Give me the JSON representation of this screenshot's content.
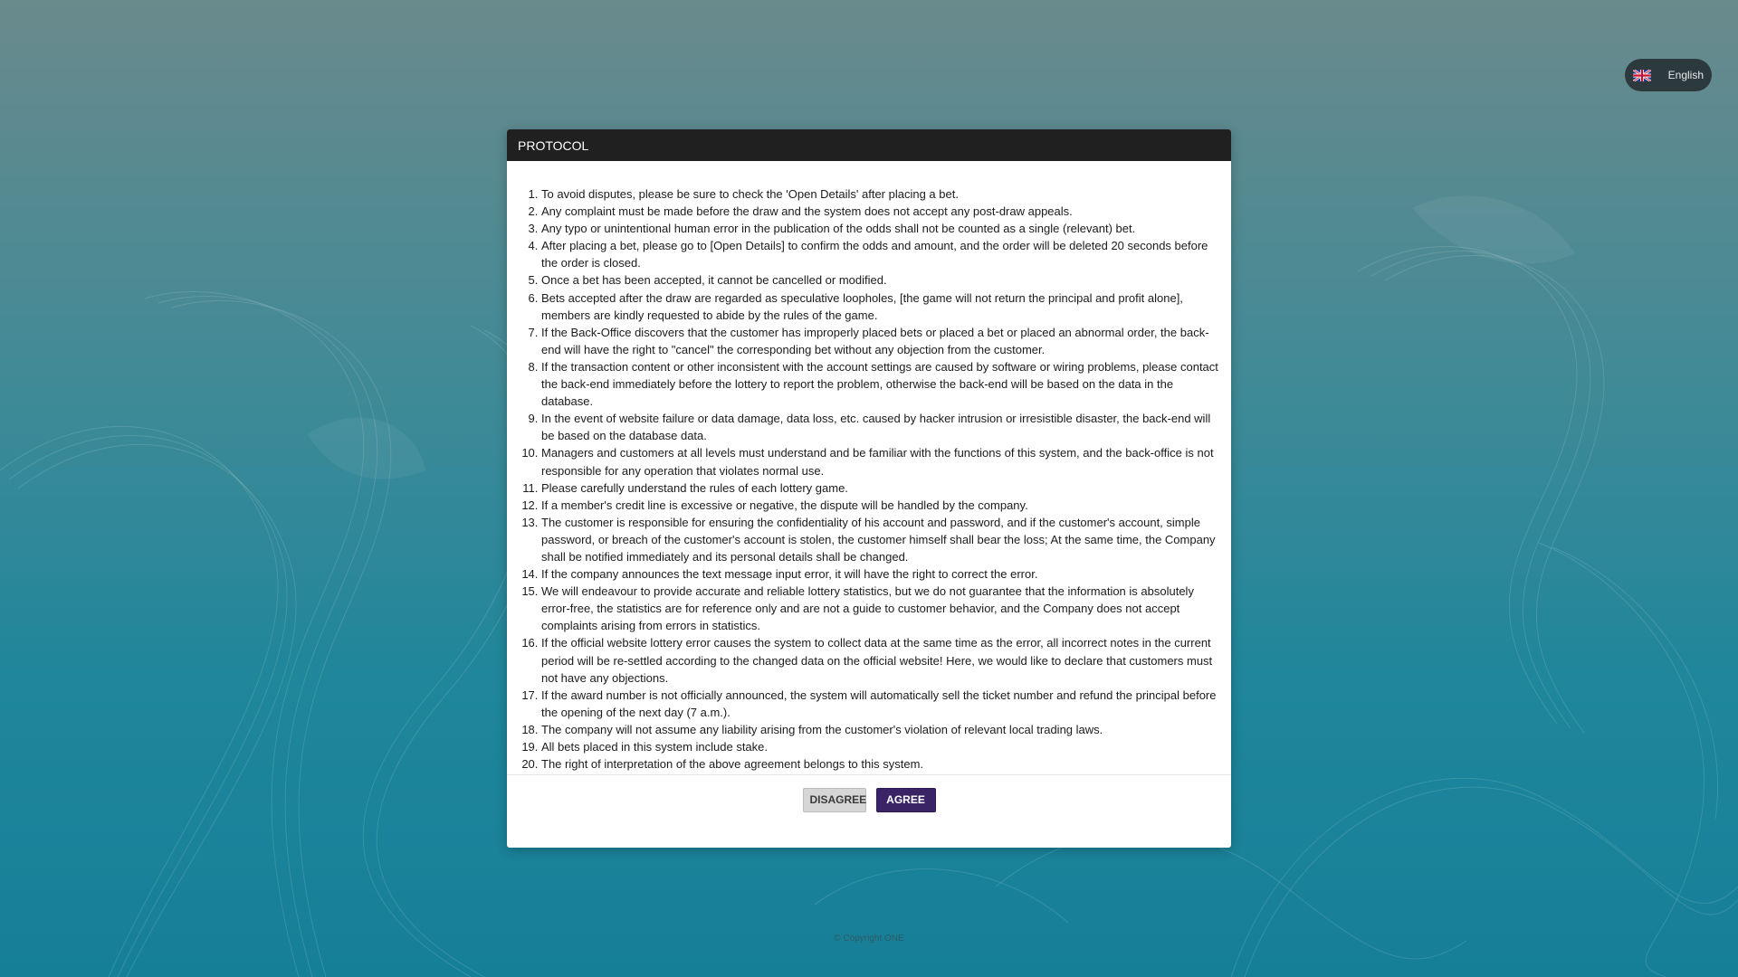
{
  "language": {
    "label": "English",
    "flag_icon": "uk-flag-icon"
  },
  "modal": {
    "title": "PROTOCOL",
    "rules": [
      "To avoid disputes, please be sure to check the 'Open Details' after placing a bet.",
      "Any complaint must be made before the draw and the system does not accept any post-draw appeals.",
      "Any typo or unintentional human error in the publication of the odds shall not be counted as a single (relevant) bet.",
      "After placing a bet, please go to [Open Details] to confirm the odds and amount, and the order will be deleted 20 seconds before the order is closed.",
      "Once a bet has been accepted, it cannot be cancelled or modified.",
      "Bets accepted after the draw are regarded as speculative loopholes, [the game will not return the principal and profit alone], members are kindly requested to abide by the rules of the game.",
      "If the Back-Office discovers that the customer has improperly placed bets or placed a bet or placed an abnormal order, the back-end will have the right to \"cancel\" the corresponding bet without any objection from the customer.",
      "If the transaction content or other inconsistent with the account settings are caused by software or wiring problems, please contact the back-end immediately before the lottery to report the problem, otherwise the back-end will be based on the data in the database.",
      "In the event of website failure or data damage, data loss, etc. caused by hacker intrusion or irresistible disaster, the back-end will be based on the database data.",
      "Managers and customers at all levels must understand and be familiar with the functions of this system, and the back-office is not responsible for any operation that violates normal use.",
      "Please carefully understand the rules of each lottery game.",
      "If a member's credit line is excessive or negative, the dispute will be handled by the company.",
      "The customer is responsible for ensuring the confidentiality of his account and password, and if the customer's account, simple password, or breach of the customer's account is stolen, the customer himself shall bear the loss; At the same time, the Company shall be notified immediately and its personal details shall be changed.",
      "If the company announces the text message input error, it will have the right to correct the error.",
      "We will endeavour to provide accurate and reliable lottery statistics, but we do not guarantee that the information is absolutely error-free, the statistics are for reference only and are not a guide to customer behavior, and the Company does not accept complaints arising from errors in statistics.",
      "If the official website lottery error causes the system to collect data at the same time as the error, all incorrect notes in the current period will be re-settled according to the changed data on the official website! Here, we would like to declare that customers must not have any objections.",
      "If the award number is not officially announced, the system will automatically sell the ticket number and refund the principal before the opening of the next day (7 a.m.).",
      "The company will not assume any liability arising from the customer's violation of relevant local trading laws.",
      "All bets placed in this system include stake.",
      "The right of interpretation of the above agreement belongs to this system."
    ],
    "disagree_label": "DISAGREE",
    "agree_label": "AGREE"
  },
  "footer": {
    "copyright": "© Copyright ONE"
  },
  "colors": {
    "header_bg": "#202020",
    "agree_bg": "#3a2466",
    "disagree_bg": "#d6d6d6",
    "background_teal": "#1f869b"
  }
}
